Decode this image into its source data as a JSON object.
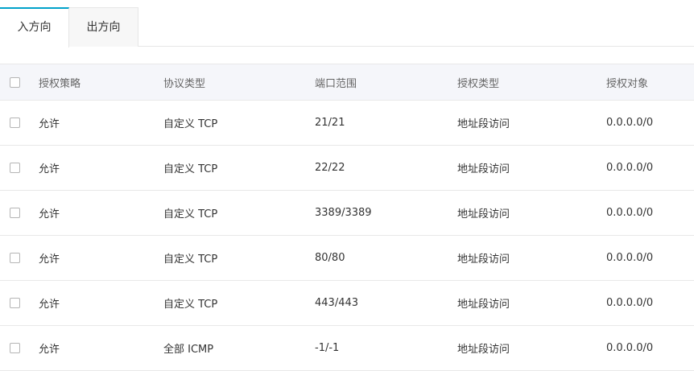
{
  "tabs": {
    "inbound": "入方向",
    "outbound": "出方向"
  },
  "table": {
    "headers": {
      "policy": "授权策略",
      "protocol": "协议类型",
      "port_range": "端口范围",
      "auth_type": "授权类型",
      "auth_object": "授权对象"
    },
    "rows": [
      {
        "policy": "允许",
        "protocol": "自定义 TCP",
        "port_range": "21/21",
        "auth_type": "地址段访问",
        "auth_object": "0.0.0.0/0"
      },
      {
        "policy": "允许",
        "protocol": "自定义 TCP",
        "port_range": "22/22",
        "auth_type": "地址段访问",
        "auth_object": "0.0.0.0/0"
      },
      {
        "policy": "允许",
        "protocol": "自定义 TCP",
        "port_range": "3389/3389",
        "auth_type": "地址段访问",
        "auth_object": "0.0.0.0/0"
      },
      {
        "policy": "允许",
        "protocol": "自定义 TCP",
        "port_range": "80/80",
        "auth_type": "地址段访问",
        "auth_object": "0.0.0.0/0"
      },
      {
        "policy": "允许",
        "protocol": "自定义 TCP",
        "port_range": "443/443",
        "auth_type": "地址段访问",
        "auth_object": "0.0.0.0/0"
      },
      {
        "policy": "允许",
        "protocol": "全部 ICMP",
        "port_range": "-1/-1",
        "auth_type": "地址段访问",
        "auth_object": "0.0.0.0/0"
      }
    ]
  },
  "colors": {
    "active_tab_accent": "#00a2ca",
    "header_background": "#f5f6fa",
    "border": "#e8e8e8"
  }
}
